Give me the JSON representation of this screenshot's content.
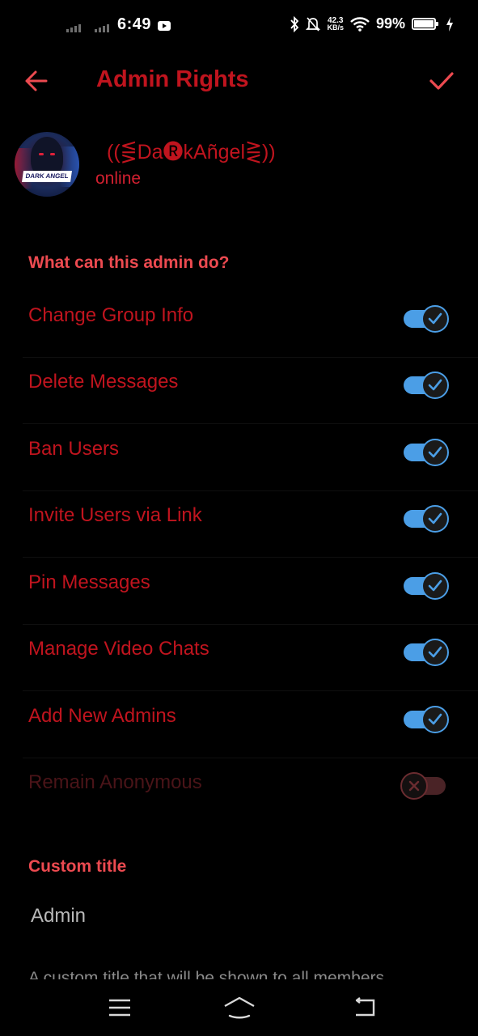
{
  "status_bar": {
    "time": "6:49",
    "net_speed_value": "42.3",
    "net_speed_unit": "KB/s",
    "battery_percent": "99%",
    "icons": [
      "signal-icon",
      "youtube-icon",
      "bluetooth-icon",
      "mute-icon",
      "wifi-icon",
      "battery-icon",
      "charging-icon"
    ]
  },
  "app_bar": {
    "title": "Admin Rights",
    "back_icon": "arrow-left-icon",
    "done_icon": "checkmark-icon"
  },
  "profile": {
    "name": "((⋚Da🅡kAñgel⋛))",
    "status": "online",
    "avatar_text": "DARK ANGEL"
  },
  "permissions": {
    "header": "What can this admin do?",
    "items": [
      {
        "label": "Change Group Info",
        "enabled": true
      },
      {
        "label": "Delete Messages",
        "enabled": true
      },
      {
        "label": "Ban Users",
        "enabled": true
      },
      {
        "label": "Invite Users via Link",
        "enabled": true
      },
      {
        "label": "Pin Messages",
        "enabled": true
      },
      {
        "label": "Manage Video Chats",
        "enabled": true
      },
      {
        "label": "Add New Admins",
        "enabled": true
      },
      {
        "label": "Remain Anonymous",
        "enabled": false
      }
    ]
  },
  "custom_title": {
    "header": "Custom title",
    "value": "Admin",
    "hint": "A custom title that will be shown to all members"
  },
  "colors": {
    "accent_red": "#c0141e",
    "header_red": "#ec4a50",
    "toggle_blue": "#4b9ee6",
    "background": "#000000"
  },
  "nav_bar": {
    "icons": [
      "menu-icon",
      "home-icon",
      "back-icon"
    ]
  }
}
